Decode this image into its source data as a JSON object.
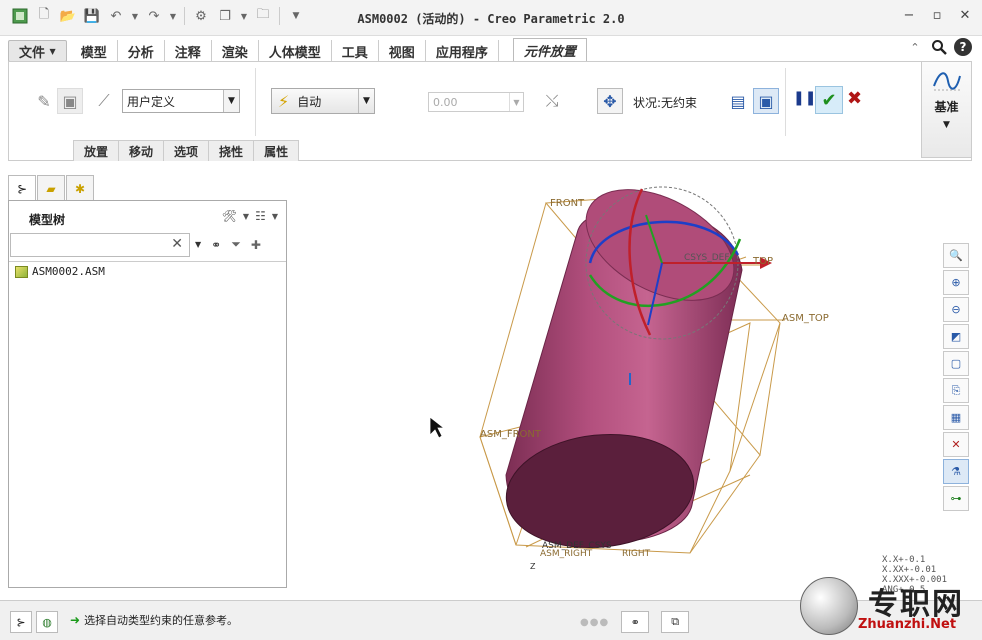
{
  "window": {
    "title": "ASM0002 (活动的) - Creo Parametric 2.0",
    "controls": [
      "−",
      "▫",
      "✕"
    ]
  },
  "quick_access": {
    "icons": [
      "app-icon",
      "new-icon",
      "open-icon",
      "save-icon",
      "undo-icon",
      "redo-icon",
      "regenerate-icon",
      "windows-icon",
      "close-window-icon",
      "customize-icon"
    ]
  },
  "ribbon_tabs": [
    "文件",
    "模型",
    "分析",
    "注释",
    "渲染",
    "人体模型",
    "工具",
    "视图",
    "应用程序",
    "元件放置"
  ],
  "ribbon": {
    "constraint_set": "用户定义",
    "constraint_type": "自动",
    "offset_value": "0.00",
    "status": "状况:无约束",
    "datum_label": "基准",
    "subtabs": [
      "放置",
      "移动",
      "选项",
      "挠性",
      "属性"
    ]
  },
  "panel": {
    "title": "模型树",
    "search_clear": "✕",
    "tree": [
      {
        "label": "ASM0002.ASM"
      }
    ]
  },
  "viewport": {
    "labels": {
      "front": "FRONT",
      "top": "TOP",
      "csys_top": "CSYS_DEF",
      "asm_top": "ASM_TOP",
      "asm_front": "ASM_FRONT",
      "asm_def_csys": "ASM_DEF_CSYS",
      "asm_right": "ASM_RIGHT",
      "right": "RIGHT",
      "axis_z": "Z"
    },
    "tolerances": [
      "X.X+-0.1",
      "X.XX+-0.01",
      "X.XXX+-0.001",
      "ANG+-0.5"
    ],
    "colors": {
      "part": "#a3436e",
      "bbox": "#c99a4a"
    }
  },
  "statusbar": {
    "message": "选择自动类型约束的任意参考。"
  },
  "watermark": {
    "cn": "专职网",
    "en": "Zhuanzhi.Net"
  }
}
